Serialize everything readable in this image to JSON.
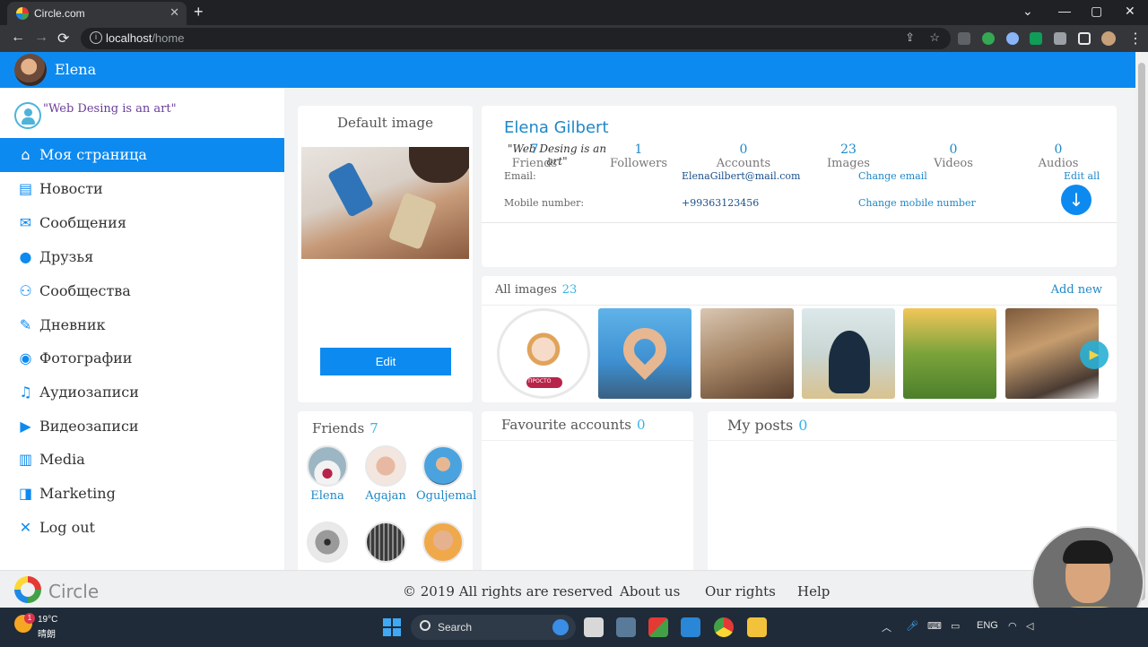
{
  "browser": {
    "tab_title": "Circle.com",
    "tab_close": "✕",
    "new_tab": "+",
    "url_host": "localhost",
    "url_path": "/home",
    "back": "←",
    "forward": "→",
    "reload": "⟳"
  },
  "header": {
    "user_name": "Elena"
  },
  "sidebar": {
    "status": "\"Web Desing is an art\"",
    "items": [
      {
        "label": "Моя страница",
        "icon": "⌂"
      },
      {
        "label": "Новости",
        "icon": "▤"
      },
      {
        "label": "Сообщения",
        "icon": "✉"
      },
      {
        "label": "Друзья",
        "icon": "●"
      },
      {
        "label": "Сообщества",
        "icon": "⚇"
      },
      {
        "label": "Дневник",
        "icon": "✎"
      },
      {
        "label": "Фотографии",
        "icon": "◉"
      },
      {
        "label": "Аудиозаписи",
        "icon": "♫"
      },
      {
        "label": "Видеозаписи",
        "icon": "▶"
      },
      {
        "label": "Media",
        "icon": "▥"
      },
      {
        "label": "Marketing",
        "icon": "◨"
      },
      {
        "label": "Log out",
        "icon": "✕"
      }
    ]
  },
  "default_image": {
    "title": "Default image",
    "edit_label": "Edit"
  },
  "profile": {
    "full_name": "Elena Gilbert",
    "status": "\"Web Desing is an art\"",
    "email_label": "Email:",
    "email_value": "ElenaGilbert@mail.com",
    "change_email": "Change email",
    "edit_all": "Edit all",
    "mobile_label": "Mobile number:",
    "mobile_value": "+99363123456",
    "change_mobile": "Change mobile number",
    "download_icon": "↓",
    "stats": [
      {
        "n": "7",
        "l": "Friends"
      },
      {
        "n": "1",
        "l": "Followers"
      },
      {
        "n": "0",
        "l": "Accounts"
      },
      {
        "n": "23",
        "l": "Images"
      },
      {
        "n": "0",
        "l": "Videos"
      },
      {
        "n": "0",
        "l": "Audios"
      }
    ]
  },
  "all_images": {
    "title": "All images",
    "count": "23",
    "add_new": "Add new",
    "play_icon": "▶",
    "thumb0_text": "ПРОСТО"
  },
  "friends": {
    "title": "Friends",
    "count": "7",
    "items": [
      {
        "name": "Elena"
      },
      {
        "name": "Agajan"
      },
      {
        "name": "Oguljemal"
      },
      {
        "name": ""
      },
      {
        "name": ""
      },
      {
        "name": ""
      }
    ]
  },
  "favourite_accounts": {
    "title": "Favourite accounts",
    "count": "0"
  },
  "my_posts": {
    "title": "My posts",
    "count": "0"
  },
  "footer": {
    "brand": "Circle",
    "copyright": "© 2019  All rights are reserved",
    "about": "About us",
    "rights": "Our rights",
    "help": "Help"
  },
  "taskbar": {
    "temp": "19°C",
    "condition": "晴朗",
    "weather_badge": "1",
    "search": "Search",
    "lang": "ENG"
  },
  "colors": {
    "primary": "#0d8af0",
    "accent": "#35b4e8",
    "link": "#1e88c8"
  }
}
